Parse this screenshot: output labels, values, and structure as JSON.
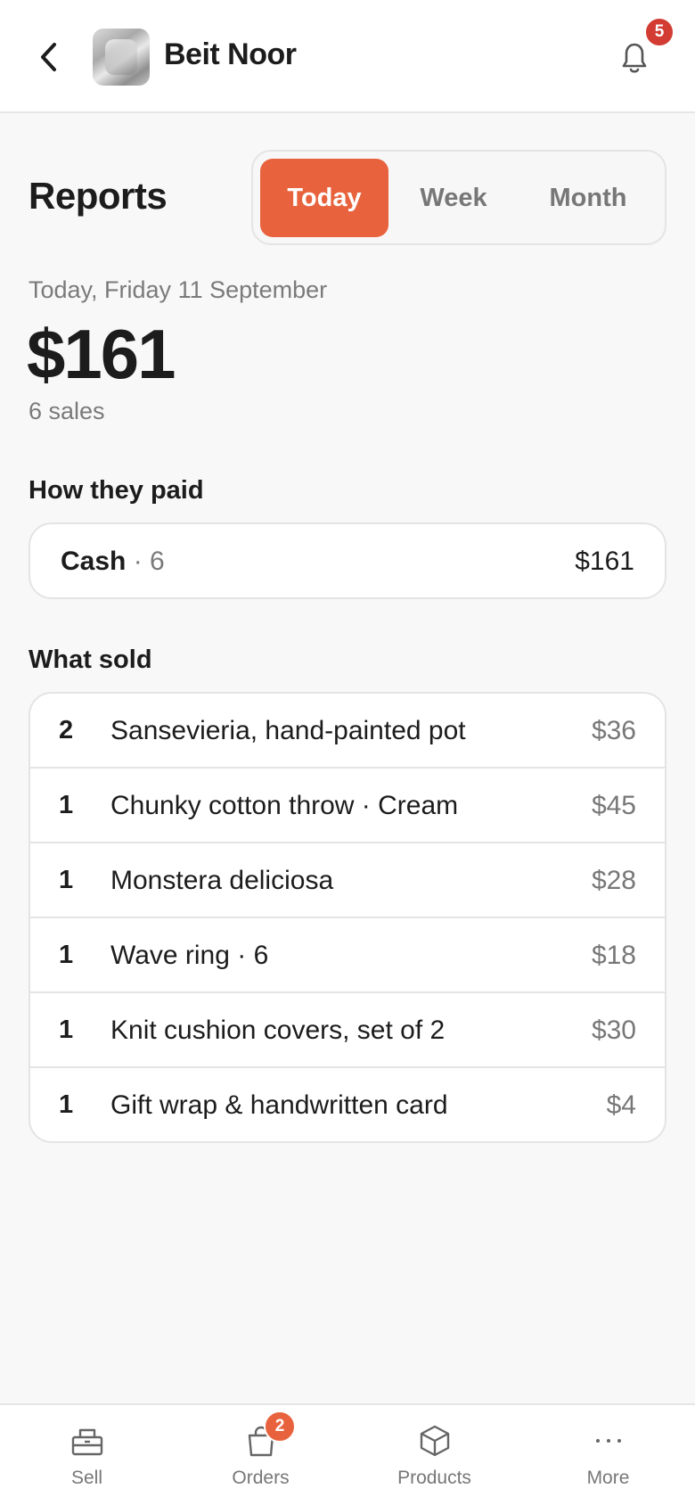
{
  "header": {
    "store_name": "Beit Noor",
    "notification_count": "5"
  },
  "reports": {
    "title": "Reports",
    "tabs": [
      {
        "label": "Today",
        "active": true
      },
      {
        "label": "Week",
        "active": false
      },
      {
        "label": "Month",
        "active": false
      }
    ],
    "date": "Today, Friday 11 September",
    "total": "$161",
    "sales_count": "6 sales"
  },
  "payments": {
    "title": "How they paid",
    "items": [
      {
        "method": "Cash",
        "separator": "·",
        "count": "6",
        "amount": "$161"
      }
    ]
  },
  "sold": {
    "title": "What sold",
    "items": [
      {
        "qty": "2",
        "name": "Sansevieria, hand-painted pot",
        "price": "$36"
      },
      {
        "qty": "1",
        "name": "Chunky cotton throw · Cream",
        "price": "$45"
      },
      {
        "qty": "1",
        "name": "Monstera deliciosa",
        "price": "$28"
      },
      {
        "qty": "1",
        "name": "Wave ring · 6",
        "price": "$18"
      },
      {
        "qty": "1",
        "name": "Knit cushion covers, set of 2",
        "price": "$30"
      },
      {
        "qty": "1",
        "name": "Gift wrap & handwritten card",
        "price": "$4"
      }
    ]
  },
  "bottom_nav": {
    "items": [
      {
        "label": "Sell",
        "icon": "register-icon"
      },
      {
        "label": "Orders",
        "icon": "bag-icon",
        "badge": "2"
      },
      {
        "label": "Products",
        "icon": "box-icon"
      },
      {
        "label": "More",
        "icon": "more-icon"
      }
    ]
  },
  "colors": {
    "accent": "#e8633d",
    "notification_badge": "#d23c33",
    "muted_text": "#777777",
    "background": "#f8f8f8"
  }
}
